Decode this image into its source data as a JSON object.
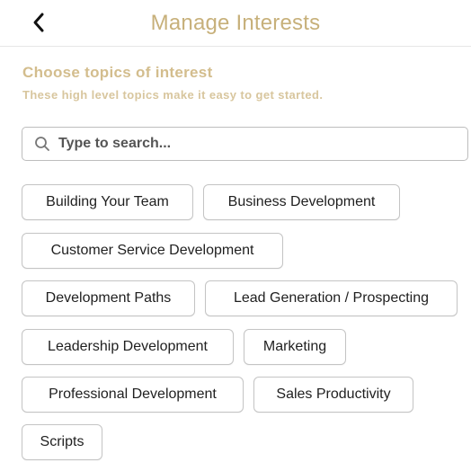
{
  "header": {
    "title": "Manage Interests",
    "back_icon": "chevron-left-icon"
  },
  "section": {
    "title": "Choose topics of interest",
    "subtitle": "These high level topics make it easy to get started."
  },
  "search": {
    "placeholder": "Type to search...",
    "value": "",
    "icon": "search-icon"
  },
  "topics": [
    "Building Your Team",
    "Business Development",
    "Customer Service Development",
    "Development Paths",
    "Lead Generation / Prospecting",
    "Leadership Development",
    "Marketing",
    "Professional Development",
    "Sales Productivity",
    "Scripts"
  ],
  "colors": {
    "accent": "#c7b07a",
    "subtitle": "#d8c69e",
    "chip_border": "#c4c4c4"
  }
}
